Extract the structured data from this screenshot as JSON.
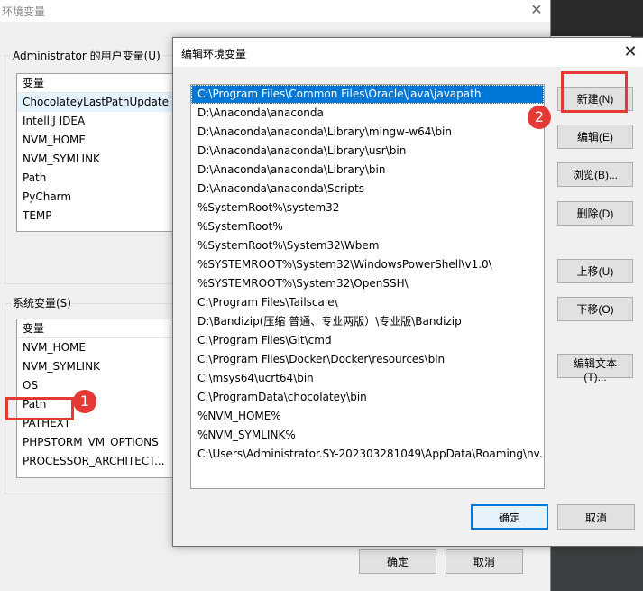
{
  "background_dialog": {
    "title": "环境变量",
    "user_group_label": "Administrator 的用户变量(U)",
    "user_list_header": "变量",
    "user_variables": [
      "ChocolateyLastPathUpdate",
      "IntelliJ IDEA",
      "NVM_HOME",
      "NVM_SYMLINK",
      "Path",
      "PyCharm",
      "TEMP"
    ],
    "system_group_label": "系统变量(S)",
    "system_list_header": "变量",
    "system_variables": [
      "NVM_HOME",
      "NVM_SYMLINK",
      "OS",
      "Path",
      "PATHEXT",
      "PHPSTORM_VM_OPTIONS",
      "PROCESSOR_ARCHITECT..."
    ],
    "ok_label": "确定",
    "cancel_label": "取消"
  },
  "edit_dialog": {
    "title": "编辑环境变量",
    "paths": [
      "C:\\Program Files\\Common Files\\Oracle\\Java\\javapath",
      "D:\\Anaconda\\anaconda",
      "D:\\Anaconda\\anaconda\\Library\\mingw-w64\\bin",
      "D:\\Anaconda\\anaconda\\Library\\usr\\bin",
      "D:\\Anaconda\\anaconda\\Library\\bin",
      "D:\\Anaconda\\anaconda\\Scripts",
      "%SystemRoot%\\system32",
      "%SystemRoot%",
      "%SystemRoot%\\System32\\Wbem",
      "%SYSTEMROOT%\\System32\\WindowsPowerShell\\v1.0\\",
      "%SYSTEMROOT%\\System32\\OpenSSH\\",
      "C:\\Program Files\\Tailscale\\",
      "D:\\Bandizip(压缩 普通、专业两版）\\专业版\\Bandizip",
      "C:\\Program Files\\Git\\cmd",
      "C:\\Program Files\\Docker\\Docker\\resources\\bin",
      "C:\\msys64\\ucrt64\\bin",
      "C:\\ProgramData\\chocolatey\\bin",
      "%NVM_HOME%",
      "%NVM_SYMLINK%",
      "C:\\Users\\Administrator.SY-202303281049\\AppData\\Roaming\\nv..."
    ],
    "buttons": {
      "new": "新建(N)",
      "edit": "编辑(E)",
      "browse": "浏览(B)...",
      "delete": "删除(D)",
      "move_up": "上移(U)",
      "move_down": "下移(O)",
      "edit_text": "编辑文本(T)..."
    },
    "ok_label": "确定",
    "cancel_label": "取消"
  },
  "annotations": {
    "badge_1": "1",
    "badge_2": "2",
    "color": "#e53935"
  }
}
